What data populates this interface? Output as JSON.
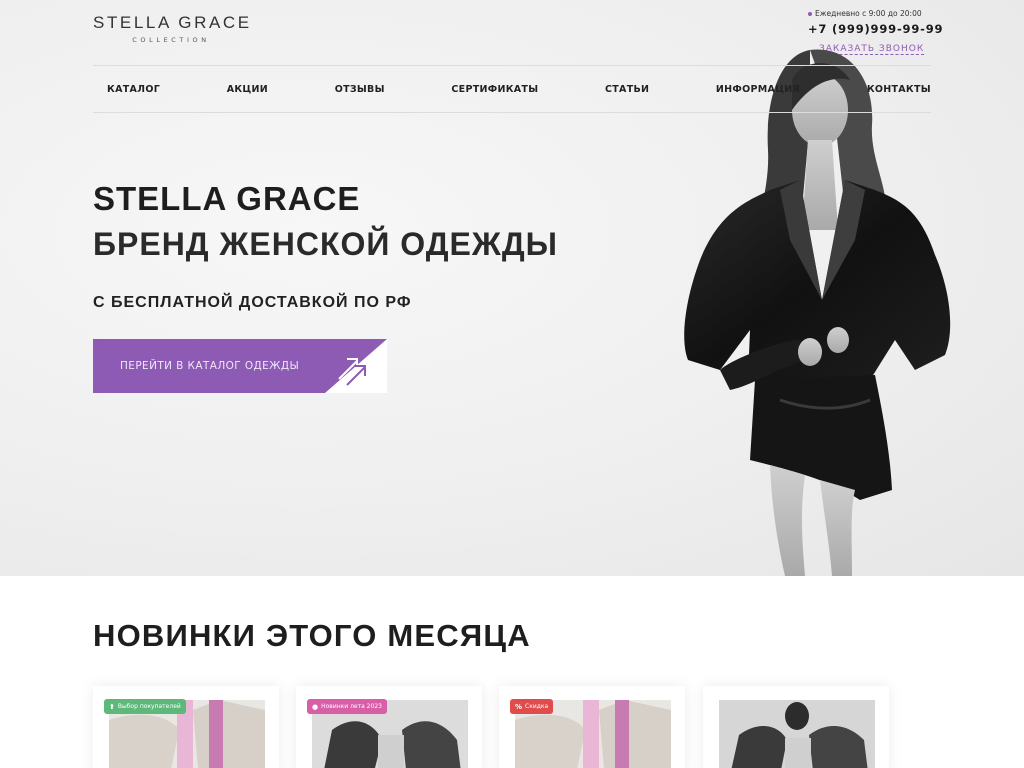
{
  "brand": {
    "name": "STELLA GRACE",
    "sub": "COLLECTION"
  },
  "contacts": {
    "hours": "Ежедневно с 9:00 до 20:00",
    "phone": "+7 (999)999-99-99",
    "callback": "ЗАКАЗАТЬ ЗВОНОК",
    "accent": "#8e5bb4"
  },
  "nav": {
    "items": [
      {
        "label": "КАТАЛОГ"
      },
      {
        "label": "АКЦИИ"
      },
      {
        "label": "ОТЗЫВЫ"
      },
      {
        "label": "СЕРТИФИКАТЫ"
      },
      {
        "label": "СТАТЬИ"
      },
      {
        "label": "ИНФОРМАЦИЯ"
      },
      {
        "label": "КОНТАКТЫ"
      }
    ]
  },
  "hero": {
    "title": "STELLA GRACE",
    "subtitle": "БРЕНД ЖЕНСКОЙ ОДЕЖДЫ",
    "delivery": "С БЕСПЛАТНОЙ ДОСТАВКОЙ ПО РФ",
    "cta": "ПЕРЕЙТИ В КАТАЛОГ ОДЕЖДЫ"
  },
  "new_arrivals": {
    "title": "НОВИНКИ ЭТОГО МЕСЯЦА",
    "cards": [
      {
        "badge": "Выбор покупателей",
        "badge_icon": "thumb-up-icon",
        "badge_color": "#5db87a"
      },
      {
        "badge": "Новинки лета 2023",
        "badge_icon": "info-icon",
        "badge_color": "#d95ea8"
      },
      {
        "badge": "Скидка",
        "badge_icon": "percent-icon",
        "badge_color": "#e04b4b"
      },
      {
        "badge": "",
        "badge_icon": "",
        "badge_color": ""
      }
    ]
  }
}
